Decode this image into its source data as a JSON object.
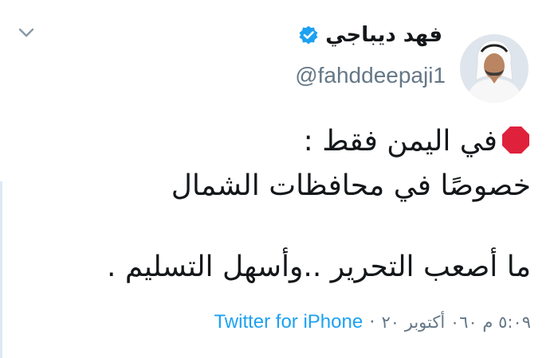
{
  "tweet": {
    "author": {
      "display_name": "فهد ديباجي",
      "handle": "@fahddeepaji1",
      "verified": true,
      "avatar_icon": "profile-photo"
    },
    "menu_icon": "chevron-down-icon",
    "body": {
      "line1": "في اليمن فقط :",
      "line1_emoji": "stop-sign-emoji",
      "line2": "خصوصًا في محافظات الشمال",
      "line3": "ما أصعب التحرير  ..وأسهل التسليم ."
    },
    "meta": {
      "timestamp": "٥:٠٩ م ٠٦٠ أكتوبر ٢٠",
      "separator": "·",
      "source": "Twitter for iPhone"
    }
  },
  "colors": {
    "link": "#1da1f2",
    "secondary_text": "#657786",
    "stop_sign": "#e0213c",
    "verified_badge": "#1da1f2"
  }
}
